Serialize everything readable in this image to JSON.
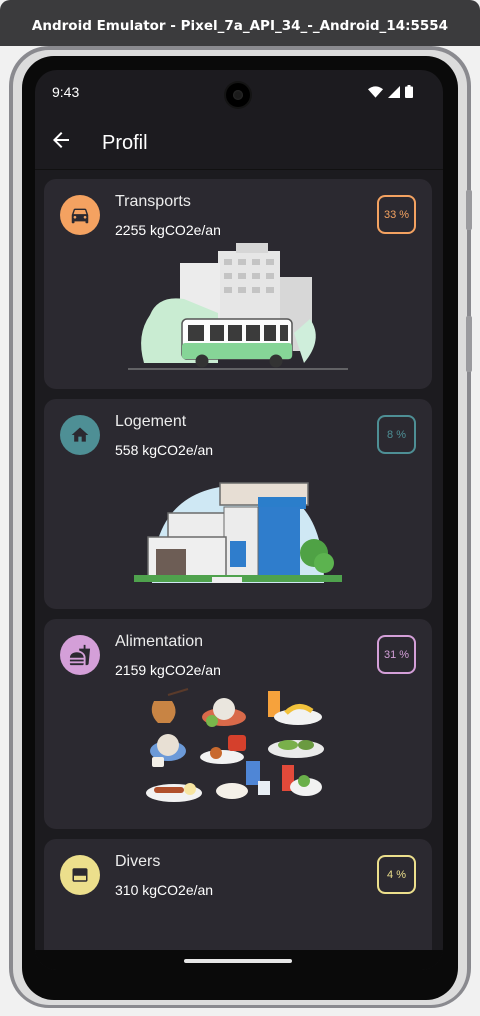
{
  "window": {
    "title": "Android Emulator - Pixel_7a_API_34_-_Android_14:5554"
  },
  "status_bar": {
    "time": "9:43",
    "icons": [
      "wifi-icon",
      "signal-icon",
      "battery-icon"
    ]
  },
  "app_bar": {
    "title": "Profil",
    "back_icon": "arrow-left-icon"
  },
  "categories": [
    {
      "title": "Transports",
      "value": "2255 kgCO2e/an",
      "percent": "33 %",
      "color": "#f4a261",
      "icon": "car-icon",
      "illustration": "city-bus-illustration"
    },
    {
      "title": "Logement",
      "value": "558 kgCO2e/an",
      "percent": "8 %",
      "color": "#4e8f95",
      "icon": "home-icon",
      "illustration": "house-illustration"
    },
    {
      "title": "Alimentation",
      "value": "2159 kgCO2e/an",
      "percent": "31 %",
      "color": "#d49fd8",
      "icon": "fastfood-icon",
      "illustration": "food-dishes-illustration"
    },
    {
      "title": "Divers",
      "value": "310 kgCO2e/an",
      "percent": "4 %",
      "color": "#ecdf8c",
      "icon": "box-icon",
      "illustration": "misc-illustration"
    }
  ]
}
